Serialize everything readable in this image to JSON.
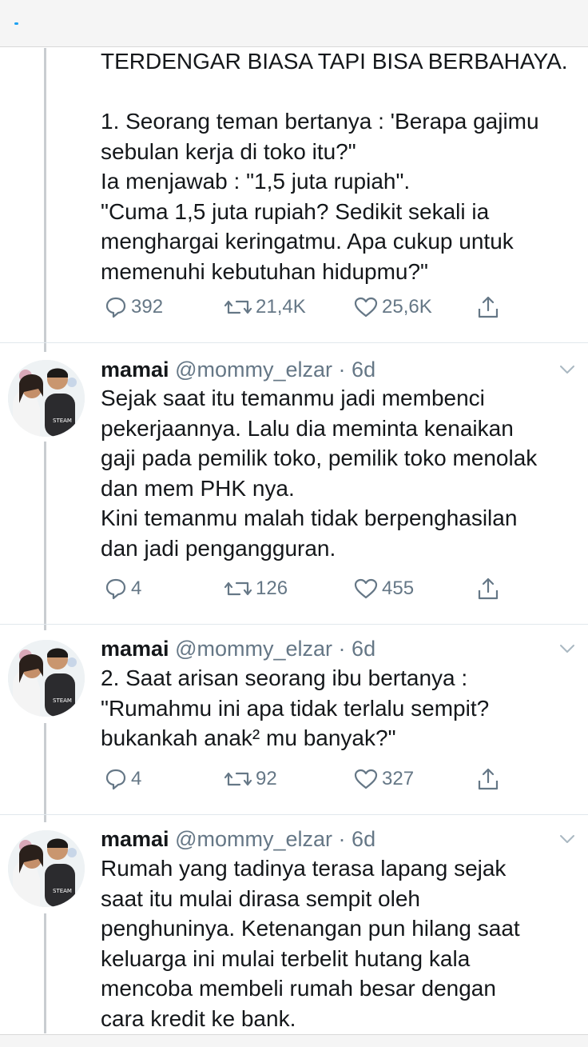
{
  "colors": {
    "text": "#14171a",
    "muted": "#657786",
    "thread_line": "#c9cdd1",
    "accent": "#1da1f2"
  },
  "tweets": [
    {
      "lines": [
        "TERDENGAR BIASA TAPI BISA BERBAHAYA.",
        "",
        "1. Seorang teman bertanya : 'Berapa gajimu",
        "sebulan kerja di toko itu?\"",
        "Ia menjawab : \"1,5 juta rupiah\".",
        "\"Cuma 1,5 juta rupiah? Sedikit sekali ia",
        "menghargai keringatmu. Apa cukup untuk",
        "memenuhi kebutuhan hidupmu?\""
      ],
      "replies": "392",
      "retweets": "21,4K",
      "likes": "25,6K"
    },
    {
      "name": "mamai",
      "handle": "@mommy_elzar",
      "sep": "·",
      "time": "6d",
      "lines": [
        "Sejak saat itu temanmu jadi membenci",
        "pekerjaannya. Lalu dia meminta kenaikan",
        "gaji pada pemilik toko, pemilik toko menolak",
        "dan mem PHK nya.",
        "Kini temanmu malah tidak berpenghasilan",
        "dan jadi pengangguran."
      ],
      "replies": "4",
      "retweets": "126",
      "likes": "455"
    },
    {
      "name": "mamai",
      "handle": "@mommy_elzar",
      "sep": "·",
      "time": "6d",
      "lines": [
        "2. Saat arisan seorang ibu bertanya :",
        "\"Rumahmu ini apa tidak terlalu sempit?",
        "bukankah anak² mu banyak?\""
      ],
      "replies": "4",
      "retweets": "92",
      "likes": "327"
    },
    {
      "name": "mamai",
      "handle": "@mommy_elzar",
      "sep": "·",
      "time": "6d",
      "lines": [
        "Rumah yang tadinya terasa lapang sejak",
        "saat itu mulai dirasa sempit oleh",
        "penghuninya. Ketenangan pun hilang saat",
        "keluarga ini mulai terbelit hutang kala",
        "mencoba membeli rumah besar dengan",
        "cara kredit ke bank."
      ]
    }
  ],
  "icons": {
    "reply": "reply-icon",
    "retweet": "retweet-icon",
    "like": "like-icon",
    "share": "share-icon",
    "chevron": "chevron-down-icon"
  }
}
